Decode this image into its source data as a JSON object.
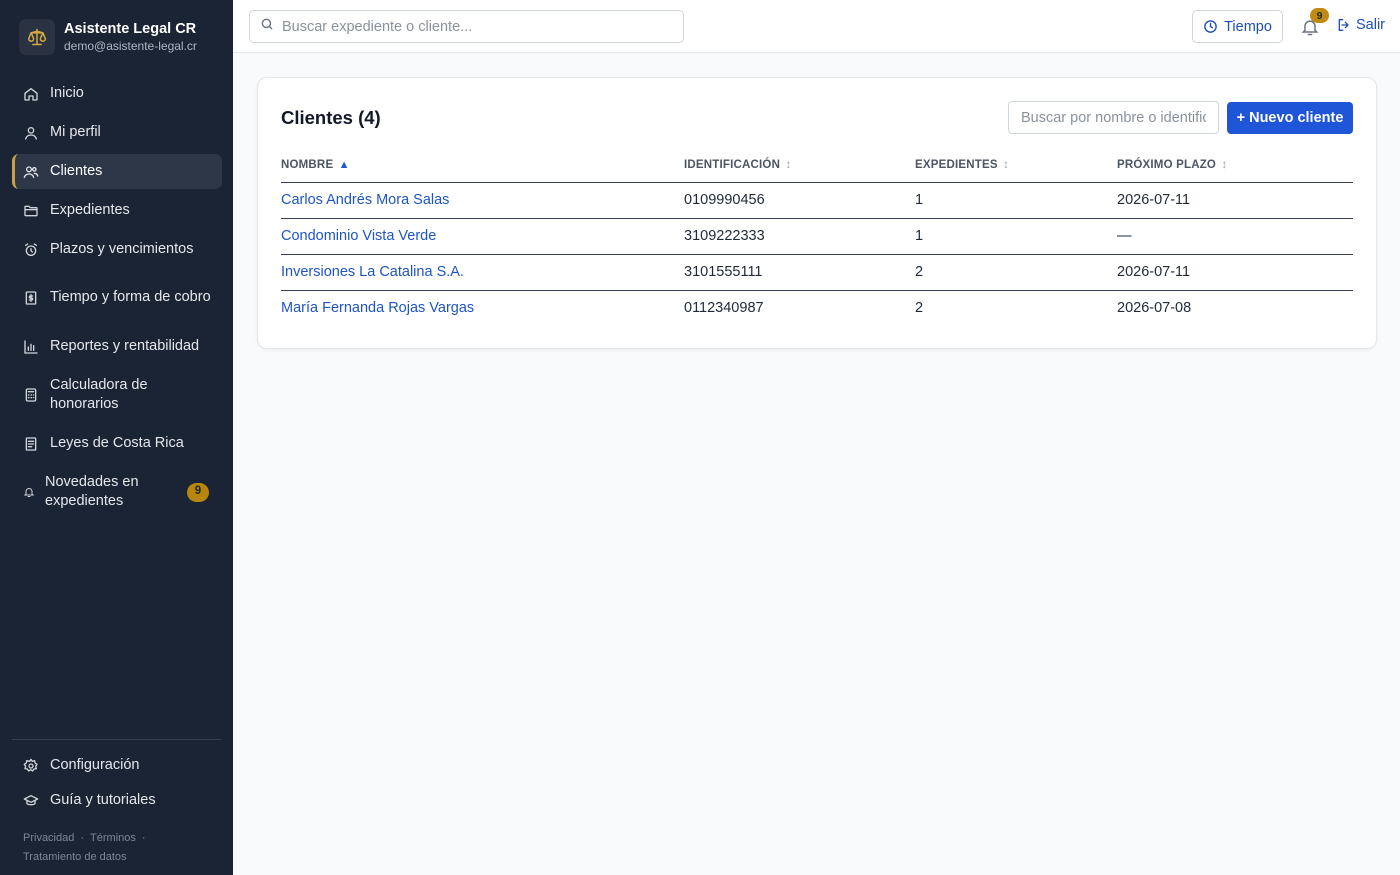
{
  "brand": {
    "name": "Asistente Legal CR",
    "email": "demo@asistente-legal.cr",
    "logo_icon": "scales-icon"
  },
  "sidebar": {
    "items": [
      {
        "label": "Inicio",
        "icon": "home-icon"
      },
      {
        "label": "Mi perfil",
        "icon": "user-icon"
      },
      {
        "label": "Clientes",
        "icon": "users-icon",
        "active": true
      },
      {
        "label": "Expedientes",
        "icon": "folder-icon"
      },
      {
        "label": "Plazos y vencimientos",
        "icon": "alarm-clock-icon"
      },
      {
        "label": "Tiempo y forma de cobro",
        "icon": "receipt-icon"
      },
      {
        "label": "Reportes y rentabilidad",
        "icon": "bar-chart-icon"
      },
      {
        "label": "Calculadora de honorarios",
        "icon": "calculator-icon"
      },
      {
        "label": "Leyes de Costa Rica",
        "icon": "book-icon"
      },
      {
        "label": "Novedades en expedientes",
        "icon": "bell-icon",
        "badge": "9"
      }
    ],
    "bottom_items": [
      {
        "label": "Configuración",
        "icon": "gear-icon"
      },
      {
        "label": "Guía y tutoriales",
        "icon": "graduation-cap-icon"
      }
    ],
    "footer_links": [
      "Privacidad",
      "Términos",
      "Tratamiento de datos"
    ]
  },
  "topbar": {
    "search_placeholder": "Buscar expediente o cliente...",
    "time_button": "Tiempo",
    "notification_count": "9",
    "logout_label": "Salir"
  },
  "clients": {
    "title": "Clientes (4)",
    "search_placeholder": "Buscar por nombre o identificación",
    "new_button": "+ Nuevo cliente",
    "columns": [
      "NOMBRE",
      "IDENTIFICACIÓN",
      "EXPEDIENTES",
      "PRÓXIMO PLAZO"
    ],
    "rows": [
      {
        "name": "Carlos Andrés Mora Salas",
        "id": "0109990456",
        "cases": "1",
        "deadline": "2026-07-11"
      },
      {
        "name": "Condominio Vista Verde",
        "id": "3109222333",
        "cases": "1",
        "deadline": "—"
      },
      {
        "name": "Inversiones La Catalina S.A.",
        "id": "3101555111",
        "cases": "2",
        "deadline": "2026-07-11"
      },
      {
        "name": "María Fernanda Rojas Vargas",
        "id": "0112340987",
        "cases": "2",
        "deadline": "2026-07-08"
      }
    ]
  },
  "colors": {
    "sidebar_bg": "#1b2434",
    "accent_blue": "#1f56d8",
    "badge_gold": "#c08a15",
    "active_border": "#c9a04a"
  }
}
